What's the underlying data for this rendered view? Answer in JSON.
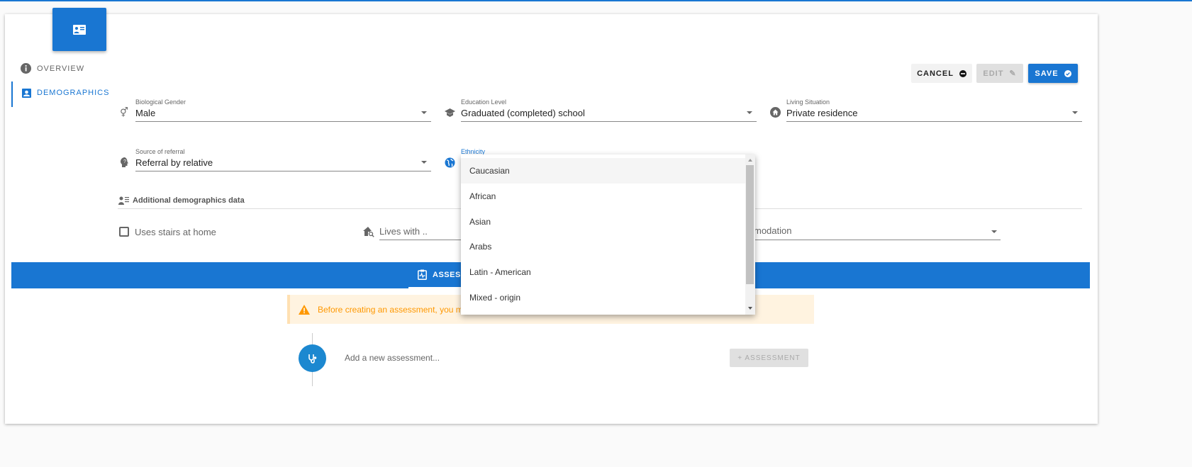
{
  "sidebar": {
    "items": [
      {
        "label": "OVERVIEW",
        "icon": "info-icon"
      },
      {
        "label": "DEMOGRAPHICS",
        "icon": "account-box-icon",
        "active": true
      }
    ]
  },
  "toolbar": {
    "cancel": "CANCEL",
    "edit": "EDIT",
    "save": "SAVE"
  },
  "fields": {
    "gender": {
      "label": "Biological Gender",
      "value": "Male"
    },
    "education": {
      "label": "Education Level",
      "value": "Graduated (completed) school"
    },
    "living": {
      "label": "Living Situation",
      "value": "Private residence"
    },
    "referral": {
      "label": "Source of referral",
      "value": "Referral by relative"
    },
    "ethnicity": {
      "label": "Ethnicity"
    }
  },
  "additional": {
    "title": "Additional demographics data",
    "stairs": "Uses stairs at home",
    "lives_with": "Lives with ..",
    "accommodation": "modation"
  },
  "tabs": {
    "assess": "ASSESS"
  },
  "warning": {
    "text": "Before creating an assessment, you m"
  },
  "assessment": {
    "placeholder": "Add a new assessment...",
    "button": "+ ASSESSMENT"
  },
  "dropdown": {
    "options": [
      "Caucasian",
      "African",
      "Asian",
      "Arabs",
      "Latin - American",
      "Mixed - origin"
    ],
    "highlighted": "Caucasian"
  },
  "colors": {
    "primary": "#1976d2",
    "warning": "#ff9800",
    "warning_bg": "#fff3e0"
  }
}
